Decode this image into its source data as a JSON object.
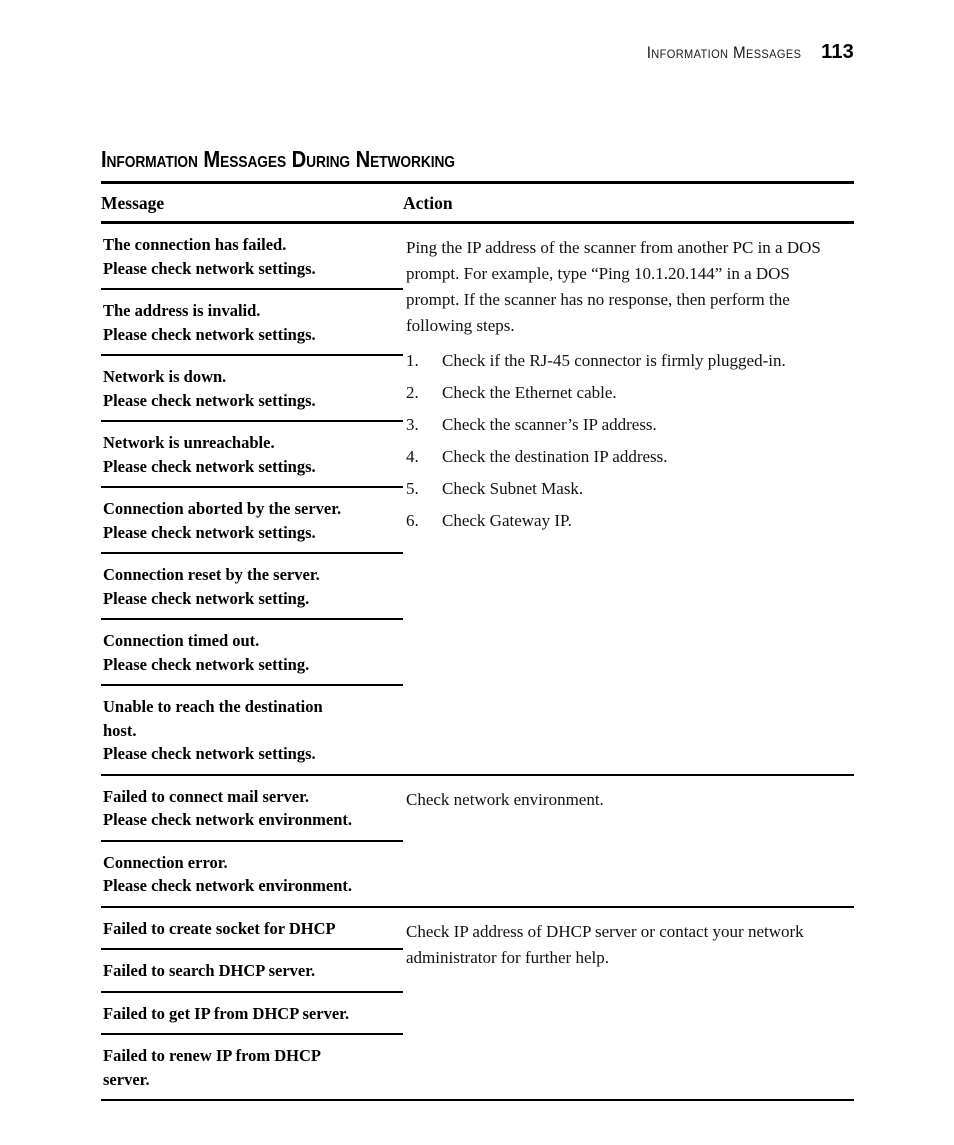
{
  "running_head": {
    "title": "Information Messages",
    "page_number": "113"
  },
  "section": {
    "heading": "Information Messages During Networking"
  },
  "table": {
    "headers": {
      "message": "Message",
      "action": "Action"
    },
    "groups": [
      {
        "id": "network-errors",
        "messages": [
          {
            "lines": [
              "The connection has failed.",
              "Please check network settings."
            ]
          },
          {
            "lines": [
              "The address is invalid.",
              "Please check network settings."
            ]
          },
          {
            "lines": [
              "Network is down.",
              "Please check network settings."
            ]
          },
          {
            "lines": [
              "Network is unreachable.",
              "Please check network settings."
            ]
          },
          {
            "lines": [
              "Connection aborted by the server.",
              "Please check network settings."
            ]
          },
          {
            "lines": [
              "Connection reset by the server.",
              "Please check network setting."
            ]
          },
          {
            "lines": [
              "Connection timed out.",
              "Please check network setting."
            ]
          },
          {
            "lines": [
              "Unable to reach the destination",
              "host.",
              "Please check network settings."
            ]
          }
        ],
        "action": {
          "paragraphs": [
            "Ping the IP address of the scanner from another PC in a DOS prompt. For example, type “Ping 10.1.20.144” in a DOS prompt. If the scanner has no response, then perform the following steps."
          ],
          "steps": [
            {
              "num": "1.",
              "text": "Check if the RJ-45 connector is firmly plugged-in."
            },
            {
              "num": "2.",
              "text": "Check the Ethernet cable."
            },
            {
              "num": "3.",
              "text": "Check the scanner’s IP address."
            },
            {
              "num": "4.",
              "text": "Check the destination IP address."
            },
            {
              "num": "5.",
              "text": "Check Subnet Mask."
            },
            {
              "num": "6.",
              "text": "Check Gateway IP."
            }
          ]
        }
      },
      {
        "id": "mail-server-errors",
        "messages": [
          {
            "lines": [
              "Failed to connect mail server.",
              "Please check network environment."
            ]
          },
          {
            "lines": [
              "Connection error.",
              "Please check network environment."
            ]
          }
        ],
        "action": {
          "paragraphs": [
            "Check network environment."
          ],
          "steps": []
        }
      },
      {
        "id": "dhcp-errors",
        "messages": [
          {
            "lines": [
              "Failed to create socket for DHCP"
            ]
          },
          {
            "lines": [
              "Failed to search DHCP server."
            ]
          },
          {
            "lines": [
              "Failed to get IP from DHCP server."
            ]
          },
          {
            "lines": [
              "Failed to renew IP from DHCP",
              "server."
            ]
          }
        ],
        "action": {
          "paragraphs": [
            "Check IP address of DHCP server or contact your network administrator for further help."
          ],
          "steps": []
        }
      }
    ]
  }
}
